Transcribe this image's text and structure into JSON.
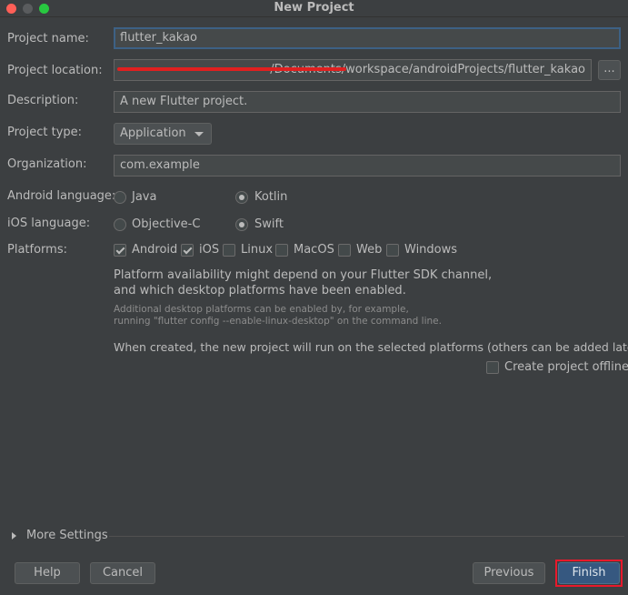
{
  "window": {
    "title": "New Project"
  },
  "form": {
    "project_name": {
      "label": "Project name:",
      "value": "flutter_kakao"
    },
    "project_location": {
      "label": "Project location:",
      "value": "~/Documents/workspace/androidProjects/flutter_kakao",
      "browse_label": "..."
    },
    "description": {
      "label": "Description:",
      "value": "A new Flutter project."
    },
    "project_type": {
      "label": "Project type:",
      "value": "Application"
    },
    "organization": {
      "label": "Organization:",
      "value": "com.example"
    },
    "android_language": {
      "label": "Android language:",
      "options": [
        "Java",
        "Kotlin"
      ],
      "selected": "Kotlin"
    },
    "ios_language": {
      "label": "iOS language:",
      "options": [
        "Objective-C",
        "Swift"
      ],
      "selected": "Swift"
    },
    "platforms": {
      "label": "Platforms:",
      "items": [
        {
          "label": "Android",
          "checked": true
        },
        {
          "label": "iOS",
          "checked": true
        },
        {
          "label": "Linux",
          "checked": false
        },
        {
          "label": "MacOS",
          "checked": false
        },
        {
          "label": "Web",
          "checked": false
        },
        {
          "label": "Windows",
          "checked": false
        }
      ]
    },
    "notes": {
      "availability_line1": "Platform availability might depend on your Flutter SDK channel,",
      "availability_line2": "and which desktop platforms have been enabled.",
      "hint_line1": "Additional desktop platforms can be enabled by, for example,",
      "hint_line2": "running \"flutter config --enable-linux-desktop\" on the command line.",
      "created_note": "When created, the new project will run on the selected platforms (others can be added later)."
    },
    "create_offline": {
      "label": "Create project offline",
      "checked": false
    }
  },
  "more_settings": {
    "label": "More Settings"
  },
  "footer": {
    "help_label": "Help",
    "cancel_label": "Cancel",
    "previous_label": "Previous",
    "finish_label": "Finish"
  },
  "colors": {
    "background": "#3c3f41",
    "field": "#45494a",
    "primary_button": "#365880",
    "annotation_red": "#e8192c"
  }
}
